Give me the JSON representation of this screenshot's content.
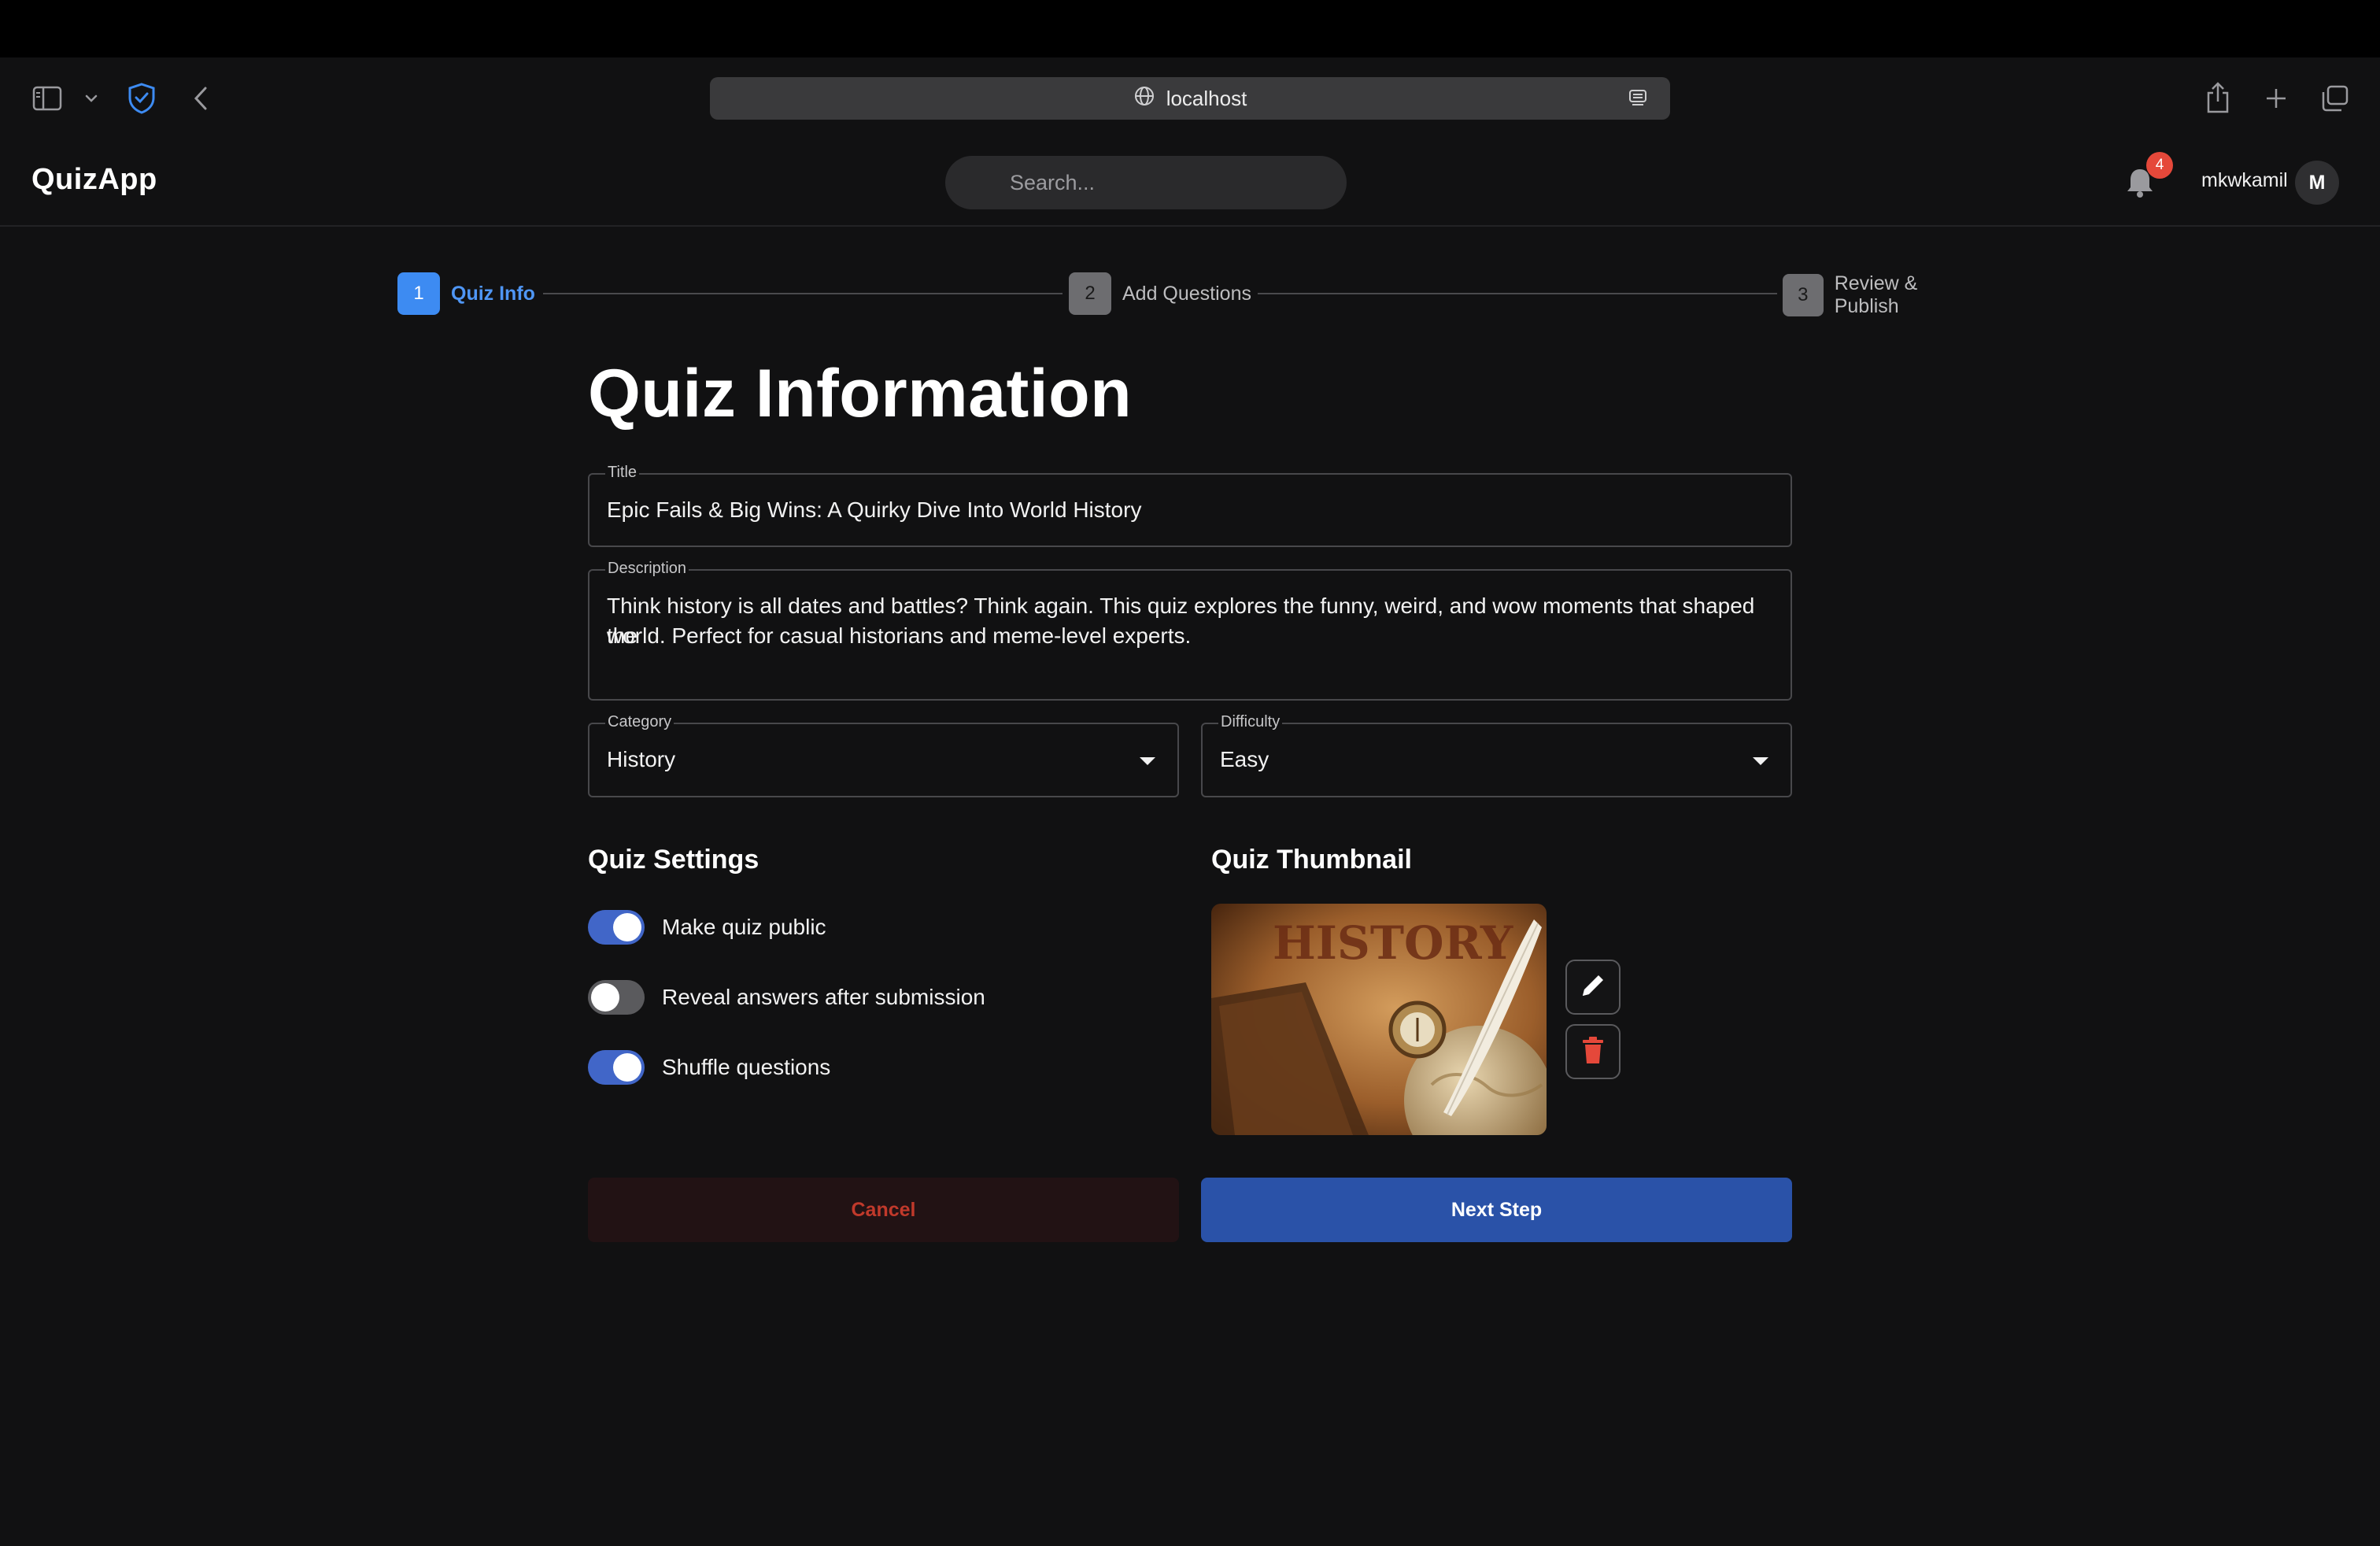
{
  "browser": {
    "url": "localhost"
  },
  "header": {
    "brand": "QuizApp",
    "search_placeholder": "Search...",
    "notification_count": "4",
    "username": "mkwkamil",
    "avatar_initial": "M"
  },
  "stepper": {
    "steps": [
      {
        "num": "1",
        "label": "Quiz Info",
        "state": "active"
      },
      {
        "num": "2",
        "label": "Add Questions",
        "state": "inactive"
      },
      {
        "num": "3",
        "label": "Review & Publish",
        "state": "inactive"
      }
    ]
  },
  "form": {
    "heading": "Quiz Information",
    "title_label": "Title",
    "title_value": "Epic Fails & Big Wins: A Quirky Dive Into World History",
    "description_label": "Description",
    "description_line1": "Think history is all dates and battles? Think again. This quiz explores the funny, weird, and wow moments that shaped the",
    "description_line2": "world. Perfect for casual historians and meme-level experts.",
    "category_label": "Category",
    "category_value": "History",
    "difficulty_label": "Difficulty",
    "difficulty_value": "Easy"
  },
  "settings": {
    "heading": "Quiz Settings",
    "toggles": [
      {
        "label": "Make quiz public",
        "on": true
      },
      {
        "label": "Reveal answers after submission",
        "on": false
      },
      {
        "label": "Shuffle questions",
        "on": true
      }
    ]
  },
  "thumbnail": {
    "heading": "Quiz Thumbnail",
    "image_text": "HISTORY"
  },
  "actions": {
    "cancel_label": "Cancel",
    "next_label": "Next Step"
  },
  "colors": {
    "accent": "#3d8bf2",
    "primary_button": "#2a52a8",
    "danger": "#c0392b",
    "badge": "#e5483a"
  }
}
